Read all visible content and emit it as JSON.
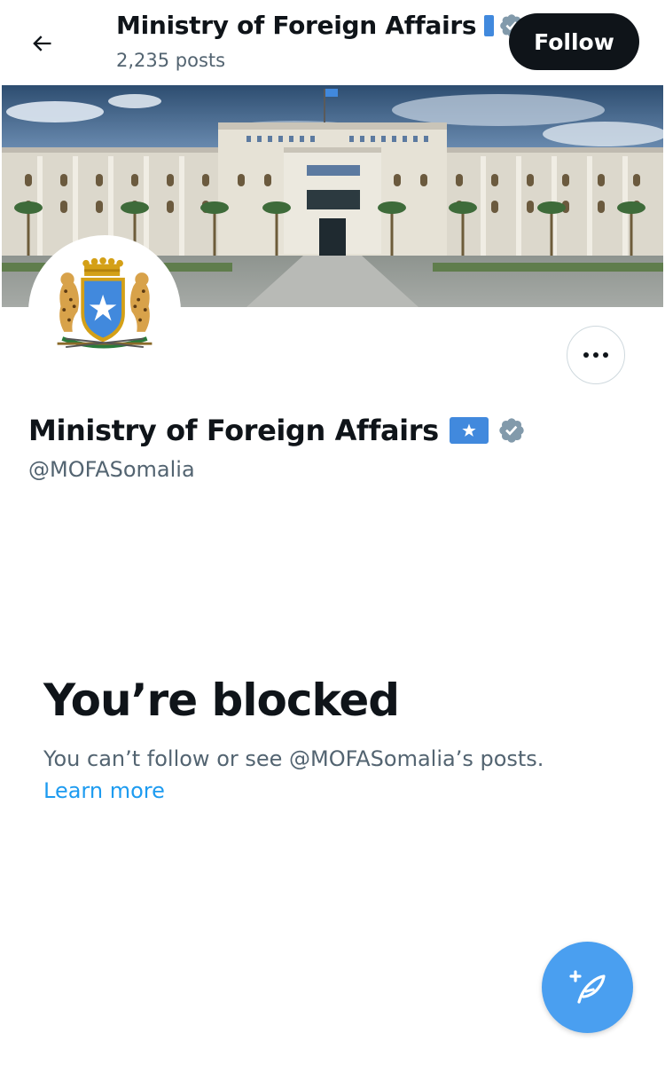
{
  "header": {
    "back_icon": "arrow-left-icon",
    "title": "Ministry of Foreign Affairs",
    "posts_count": "2,235 posts",
    "follow_label": "Follow",
    "verified_icon": "verified-badge-icon"
  },
  "profile": {
    "display_name": "Ministry of Foreign Affairs",
    "handle": "@MOFASomalia",
    "flag_icon": "somalia-flag-icon",
    "verified_icon": "verified-badge-icon",
    "more_icon": "more-horizontal-icon",
    "avatar_icon": "somalia-coat-of-arms-icon",
    "banner_icon": "ministry-building-photo"
  },
  "notice": {
    "title": "You’re blocked",
    "description": "You can’t follow or see @MOFASomalia’s posts.",
    "link_label": "Learn more"
  },
  "fab": {
    "icon": "compose-post-icon"
  },
  "colors": {
    "follow_bg": "#0f1419",
    "link": "#1d9bf0",
    "secondary_text": "#536471",
    "fab_bg": "#4a9ff0",
    "flag_blue": "#4189dd",
    "verified_grey": "#829aab"
  }
}
